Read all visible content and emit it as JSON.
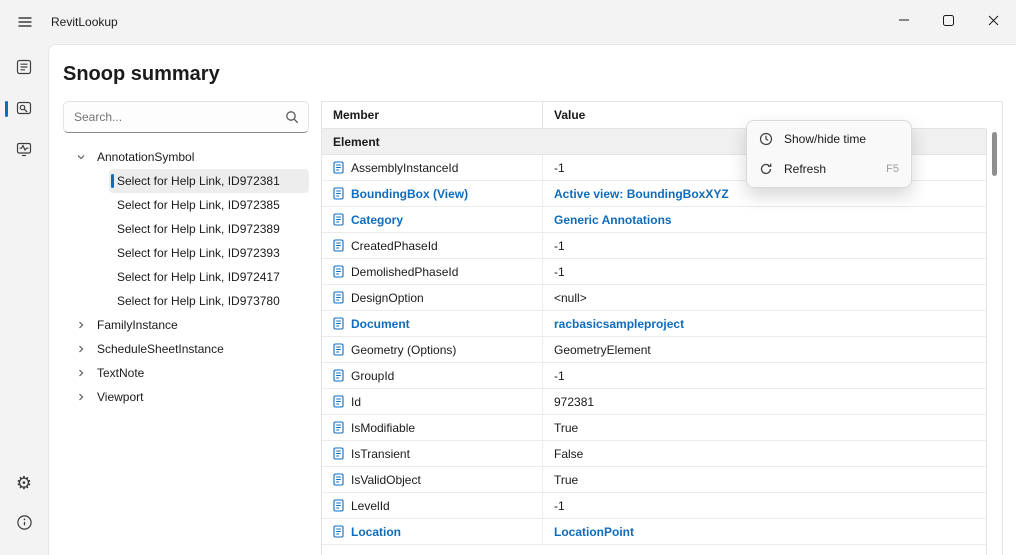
{
  "titlebar": {
    "title": "RevitLookup"
  },
  "page": {
    "title": "Snoop summary"
  },
  "search": {
    "placeholder": "Search..."
  },
  "tree": {
    "items": [
      {
        "label": "AnnotationSymbol",
        "expanded": true,
        "children": [
          {
            "label": "Select for Help Link, ID972381",
            "selected": true
          },
          {
            "label": "Select for Help Link, ID972385"
          },
          {
            "label": "Select for Help Link, ID972389"
          },
          {
            "label": "Select for Help Link, ID972393"
          },
          {
            "label": "Select for Help Link, ID972417"
          },
          {
            "label": "Select for Help Link, ID973780"
          }
        ]
      },
      {
        "label": "FamilyInstance",
        "expanded": false
      },
      {
        "label": "ScheduleSheetInstance",
        "expanded": false
      },
      {
        "label": "TextNote",
        "expanded": false
      },
      {
        "label": "Viewport",
        "expanded": false
      }
    ]
  },
  "table": {
    "columns": [
      "Member",
      "Value"
    ],
    "group": "Element",
    "rows": [
      {
        "member": "AssemblyInstanceId",
        "value": "-1",
        "link": false
      },
      {
        "member": "BoundingBox (View)",
        "value": "Active view: BoundingBoxXYZ",
        "link": true
      },
      {
        "member": "Category",
        "value": "Generic Annotations",
        "link": true
      },
      {
        "member": "CreatedPhaseId",
        "value": "-1",
        "link": false
      },
      {
        "member": "DemolishedPhaseId",
        "value": "-1",
        "link": false
      },
      {
        "member": "DesignOption",
        "value": "<null>",
        "link": false
      },
      {
        "member": "Document",
        "value": "racbasicsampleproject",
        "link": true
      },
      {
        "member": "Geometry (Options)",
        "value": "GeometryElement",
        "link": false
      },
      {
        "member": "GroupId",
        "value": "-1",
        "link": false
      },
      {
        "member": "Id",
        "value": "972381",
        "link": false
      },
      {
        "member": "IsModifiable",
        "value": "True",
        "link": false
      },
      {
        "member": "IsTransient",
        "value": "False",
        "link": false
      },
      {
        "member": "IsValidObject",
        "value": "True",
        "link": false
      },
      {
        "member": "LevelId",
        "value": "-1",
        "link": false
      },
      {
        "member": "Location",
        "value": "LocationPoint",
        "link": true
      }
    ]
  },
  "context_menu": {
    "items": [
      {
        "label": "Show/hide time",
        "icon": "clock",
        "shortcut": ""
      },
      {
        "label": "Refresh",
        "icon": "refresh",
        "shortcut": "F5"
      }
    ]
  },
  "icons": {
    "menu": "hamburger",
    "search": "magnifier",
    "settings": "gear ⚙",
    "about": "info",
    "property": "document",
    "chevron_down": "⌄",
    "chevron_right": "›",
    "minimize": "–",
    "maximize": "▢",
    "close": "✕",
    "clock": "clock",
    "refresh": "refresh-arrow"
  },
  "colors": {
    "accent": "#0f6cbd",
    "link": "#0f6cbd",
    "selection": "#ededed"
  }
}
